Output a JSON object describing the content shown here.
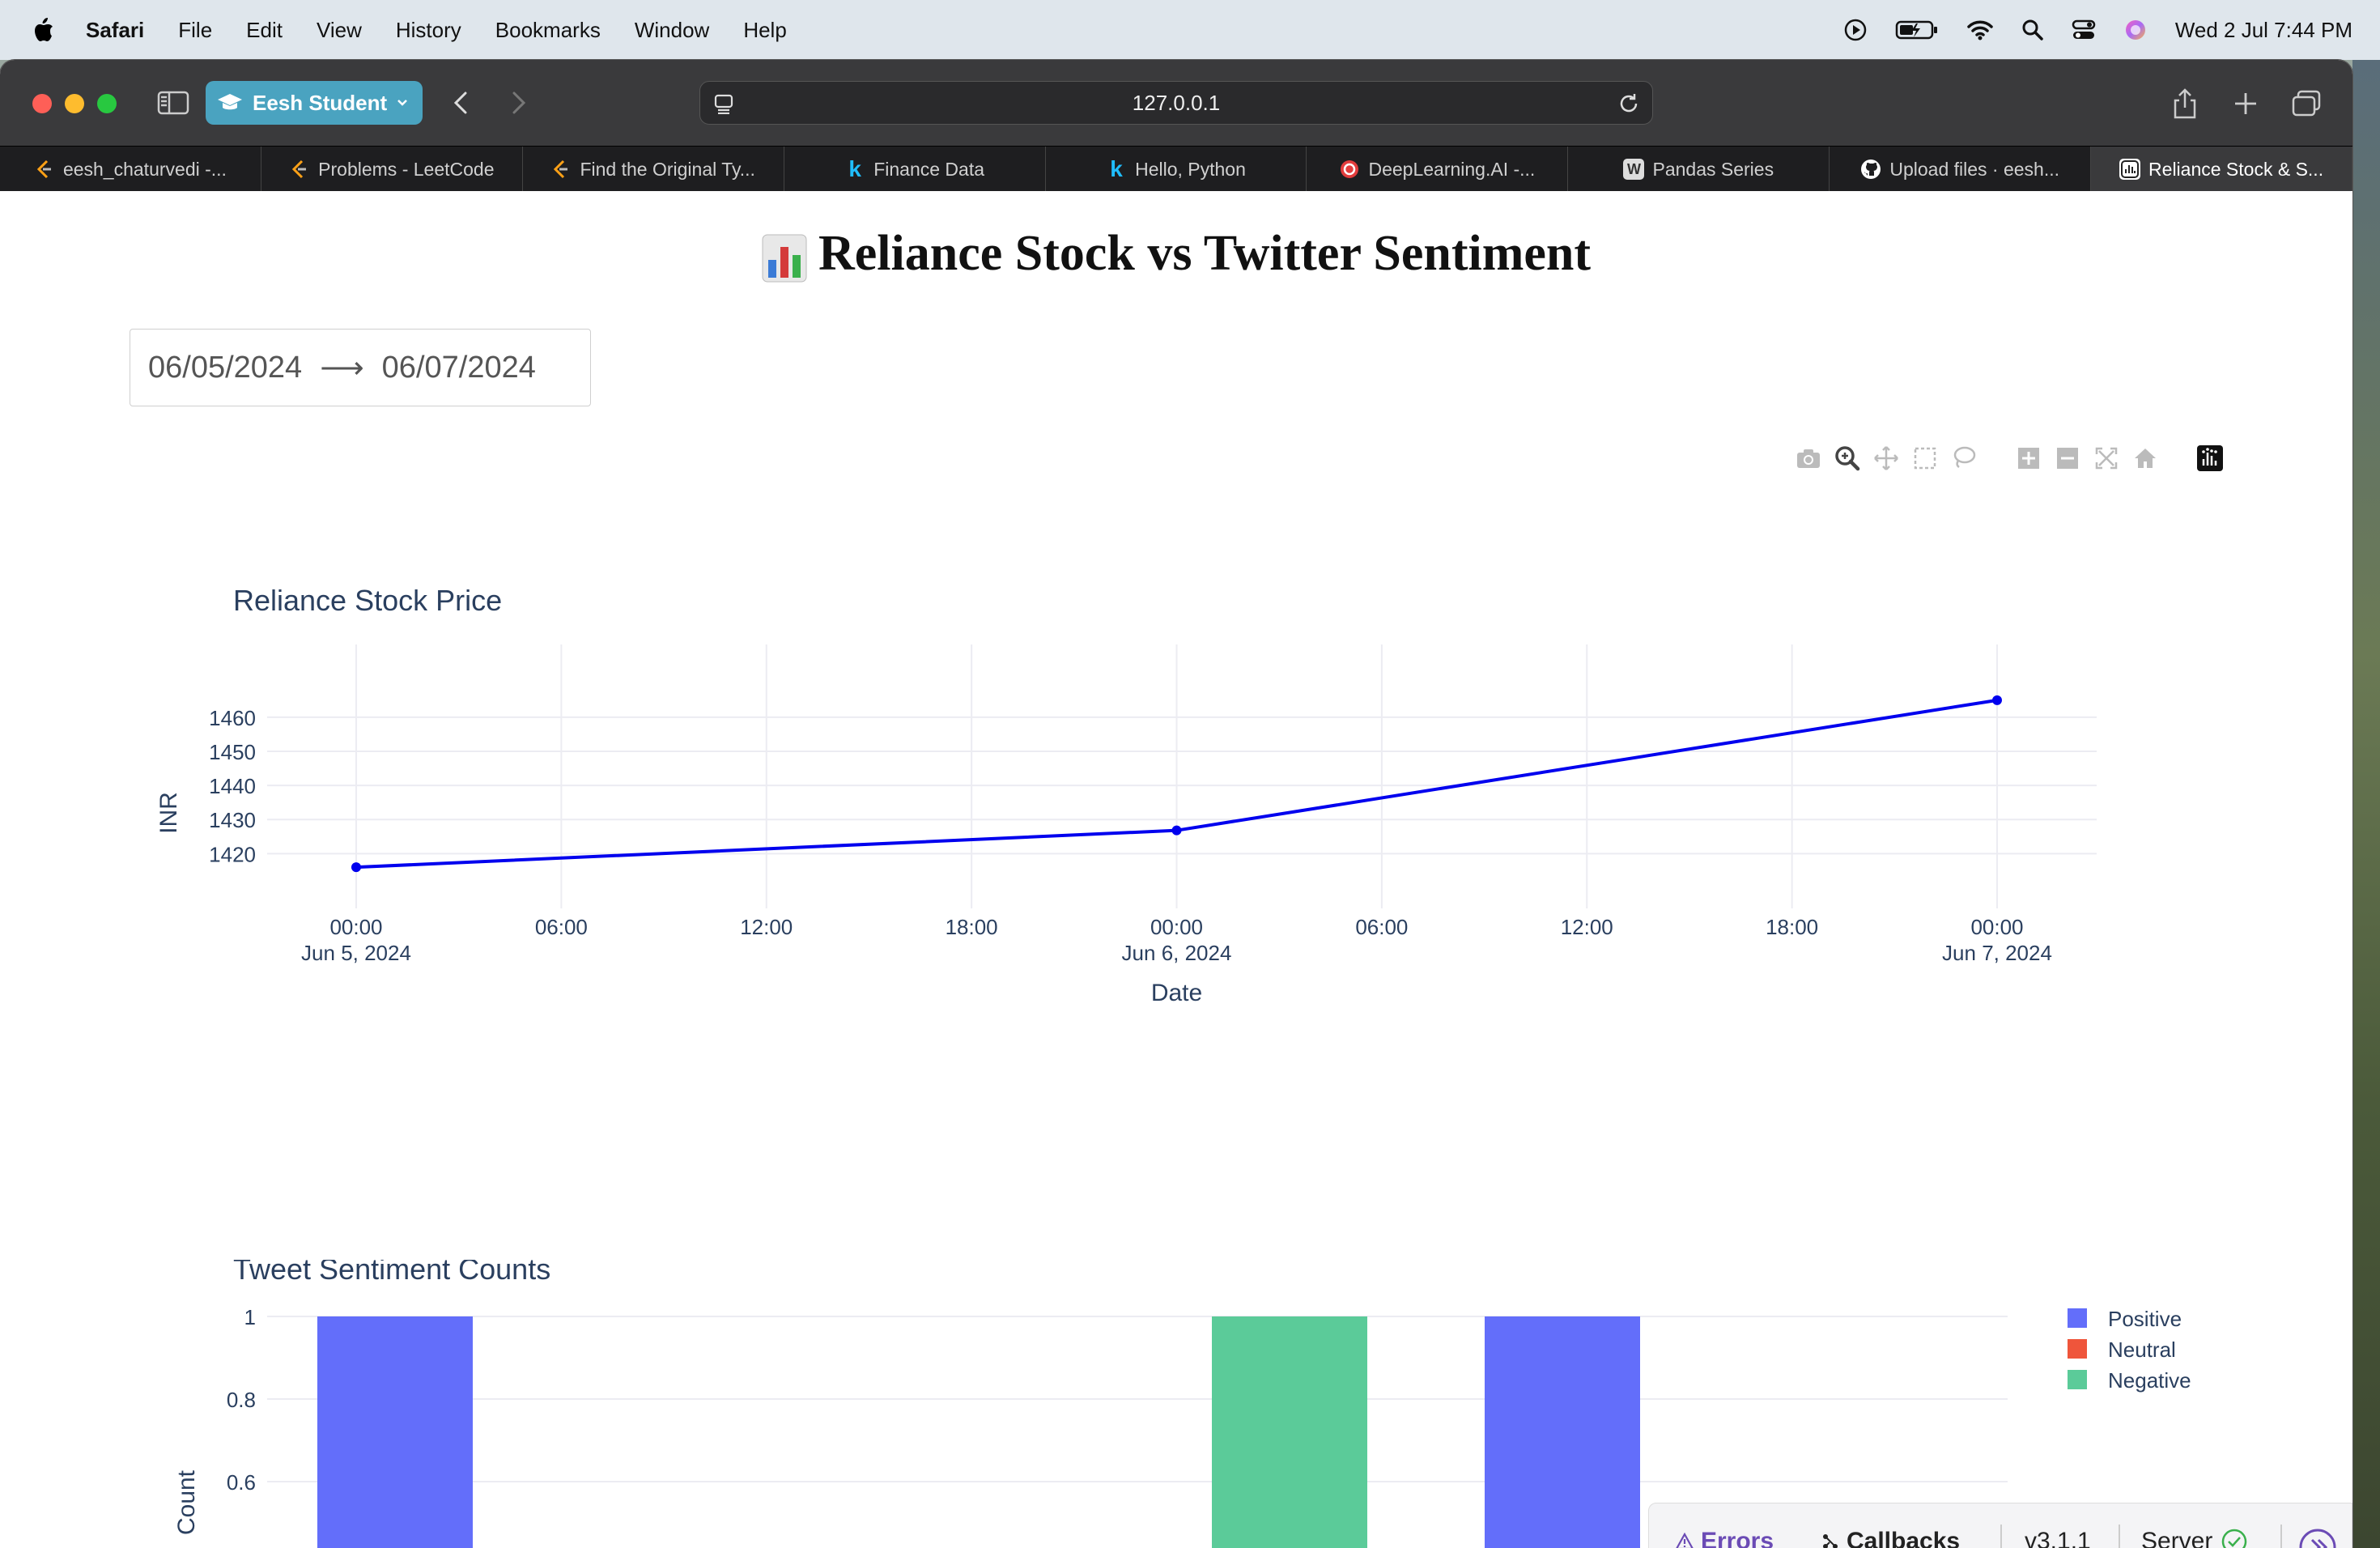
{
  "menubar": {
    "app": "Safari",
    "items": [
      "File",
      "Edit",
      "View",
      "History",
      "Bookmarks",
      "Window",
      "Help"
    ],
    "clock": "Wed 2 Jul  7:44 PM"
  },
  "browser": {
    "profile": "Eesh Student",
    "url": "127.0.0.1",
    "tabs": [
      {
        "title": "eesh_chaturvedi -...",
        "icon": "leetcode-icon"
      },
      {
        "title": "Problems - LeetCode",
        "icon": "leetcode-icon"
      },
      {
        "title": "Find the Original Ty...",
        "icon": "leetcode-icon"
      },
      {
        "title": "Finance Data",
        "icon": "kaggle-icon"
      },
      {
        "title": "Hello, Python",
        "icon": "kaggle-icon"
      },
      {
        "title": "DeepLearning.AI -...",
        "icon": "deeplearning-icon"
      },
      {
        "title": "Pandas Series",
        "icon": "w-icon"
      },
      {
        "title": "Upload files · eesh...",
        "icon": "github-icon"
      },
      {
        "title": "Reliance Stock & S...",
        "icon": "chart-icon"
      }
    ],
    "active_tab": 8
  },
  "page": {
    "title": "Reliance Stock vs Twitter Sentiment",
    "date_start": "06/05/2024",
    "date_end": "06/07/2024",
    "date_arrow": "⟶"
  },
  "colors": {
    "stock_line": "#0000ee",
    "positive": "#636efa",
    "neutral": "#ef553b",
    "negative": "#5bcb99"
  },
  "chart_data": [
    {
      "type": "line",
      "title": "Reliance Stock Price",
      "xlabel": "Date",
      "ylabel": "INR",
      "x": [
        "2024-06-05 00:00",
        "2024-06-06 00:00",
        "2024-06-07 00:00"
      ],
      "y": [
        1416,
        1426.8,
        1465
      ],
      "xlim": [
        "2024-06-05 00:00",
        "2024-06-07 00:00"
      ],
      "ylim": [
        1412,
        1469
      ],
      "yticks": [
        1420,
        1430,
        1440,
        1450,
        1460
      ],
      "xticks": [
        {
          "t": "00:00",
          "d": "Jun 5, 2024"
        },
        {
          "t": "06:00",
          "d": ""
        },
        {
          "t": "12:00",
          "d": ""
        },
        {
          "t": "18:00",
          "d": ""
        },
        {
          "t": "00:00",
          "d": "Jun 6, 2024"
        },
        {
          "t": "06:00",
          "d": ""
        },
        {
          "t": "12:00",
          "d": ""
        },
        {
          "t": "18:00",
          "d": ""
        },
        {
          "t": "00:00",
          "d": "Jun 7, 2024"
        }
      ],
      "grid": true
    },
    {
      "type": "bar",
      "title": "Tweet Sentiment Counts",
      "ylabel": "Count",
      "yticks": [
        1,
        0.8,
        0.6
      ],
      "legend": [
        "Positive",
        "Neutral",
        "Negative"
      ],
      "legend_position": "top-right",
      "bars": [
        {
          "sentiment": "Positive",
          "value": 1
        },
        {
          "sentiment": "Negative",
          "value": 1
        },
        {
          "sentiment": "Positive",
          "value": 1
        }
      ],
      "grid": true
    }
  ],
  "devtools": {
    "errors": "Errors",
    "callbacks": "Callbacks",
    "version": "v3.1.1",
    "server": "Server"
  }
}
